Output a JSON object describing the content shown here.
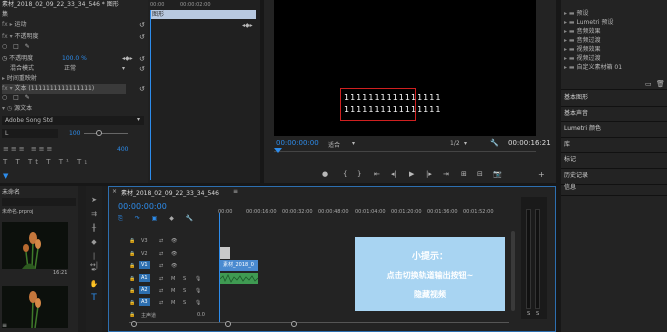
{
  "effects": {
    "title": "素材_2018_02_09_22_33_34_546 * 图形",
    "rows": [
      "集",
      "运动",
      "不透明度",
      "",
      "不透明度",
      "混合模式",
      "时间重映射",
      "文本",
      "源文本",
      "Adobe Song Std",
      "L",
      ""
    ],
    "opacity_value": "100.0 %",
    "blend_value": "正常",
    "text_value": "文本 (1111111111111111)",
    "font_size": "100",
    "tracking_value": "400"
  },
  "mini_timeline": {
    "times": [
      "00:00",
      "00:00:02:00"
    ],
    "clip_label": "图形"
  },
  "program": {
    "timecode": "00:00:00:00",
    "fit_label": "适合",
    "quality_label": "1/2",
    "duration": "00:00:16:21",
    "text_line1": "1111111111111111",
    "text_line2": "1111111111111111"
  },
  "transport": {
    "buttons": [
      "marker-icon",
      "in-point-icon",
      "out-point-icon",
      "go-to-in-icon",
      "step-back-icon",
      "play-icon",
      "step-forward-icon",
      "go-to-out-icon",
      "insert-icon",
      "overwrite-icon",
      "export-frame-icon"
    ]
  },
  "project": {
    "title": "未命名",
    "file": "未命名.prproj",
    "thumb_timecode": "16:21",
    "clip_label": "素材_2018_02_09_22_33_34_546"
  },
  "timeline": {
    "tab": "素材_2018_02_09_22_33_34_546",
    "timecode": "00:00:00:00",
    "ruler": [
      "00:00",
      "00:00:16:00",
      "00:00:32:00",
      "00:00:48:00",
      "00:01:04:00",
      "00:01:20:00",
      "00:01:36:00",
      "00:01:52:00"
    ],
    "video_tracks": [
      "V3",
      "V2",
      "V1"
    ],
    "audio_tracks": [
      "A1",
      "A2",
      "A3"
    ],
    "master": "主声道",
    "master_value": "0.0",
    "clip_v1": "素材_2018_0",
    "meter_labels": [
      "S",
      "S"
    ]
  },
  "right": {
    "effects_tree": [
      "预设",
      "Lumetri 预设",
      "音频效果",
      "音频过渡",
      "视频效果",
      "视频过渡",
      "自定义素材箱 01"
    ],
    "panels": [
      "基本图形",
      "基本声音",
      "Lumetri 颜色",
      "库",
      "标记",
      "历史记录",
      "信息"
    ]
  },
  "overlay": {
    "title": "小提示：",
    "line1": "点击切换轨道输出按钮~",
    "line2": "隐藏视频",
    "bg_color": "#a8d4f2",
    "text_color": "#ffffff"
  }
}
